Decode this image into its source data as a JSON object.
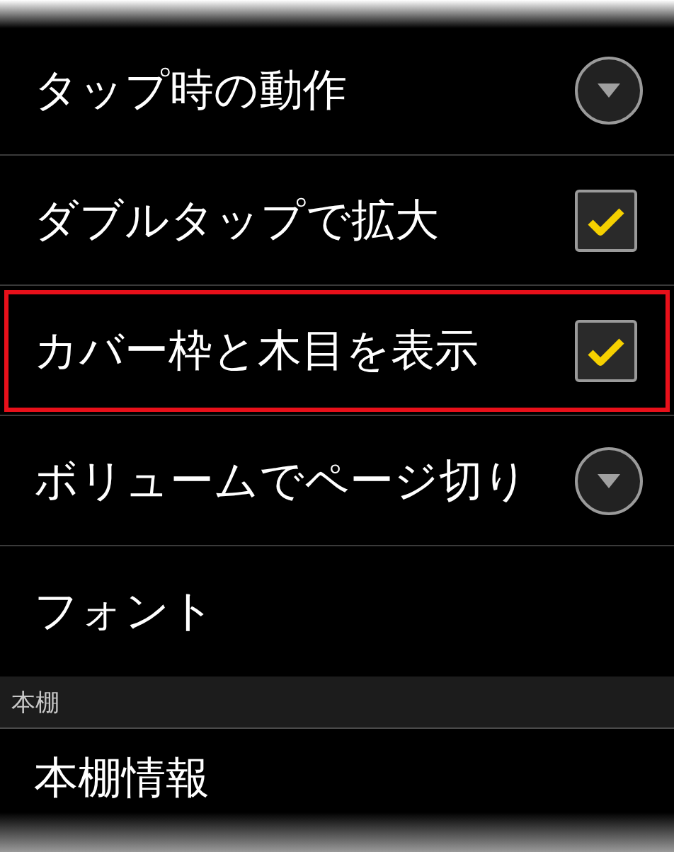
{
  "settings": [
    {
      "label": "タップ時の動作",
      "kind": "dropdown",
      "highlighted": false
    },
    {
      "label": "ダブルタップで拡大",
      "kind": "checkbox",
      "checked": true,
      "highlighted": false
    },
    {
      "label": "カバー枠と木目を表示",
      "kind": "checkbox",
      "checked": true,
      "highlighted": true
    },
    {
      "label": "ボリュームでページ切り",
      "kind": "dropdown",
      "highlighted": false
    },
    {
      "label": "フォント",
      "kind": "plain",
      "highlighted": false
    }
  ],
  "section": {
    "title": "本棚",
    "items": [
      {
        "label": "本棚情報",
        "highlighted": false
      }
    ]
  }
}
